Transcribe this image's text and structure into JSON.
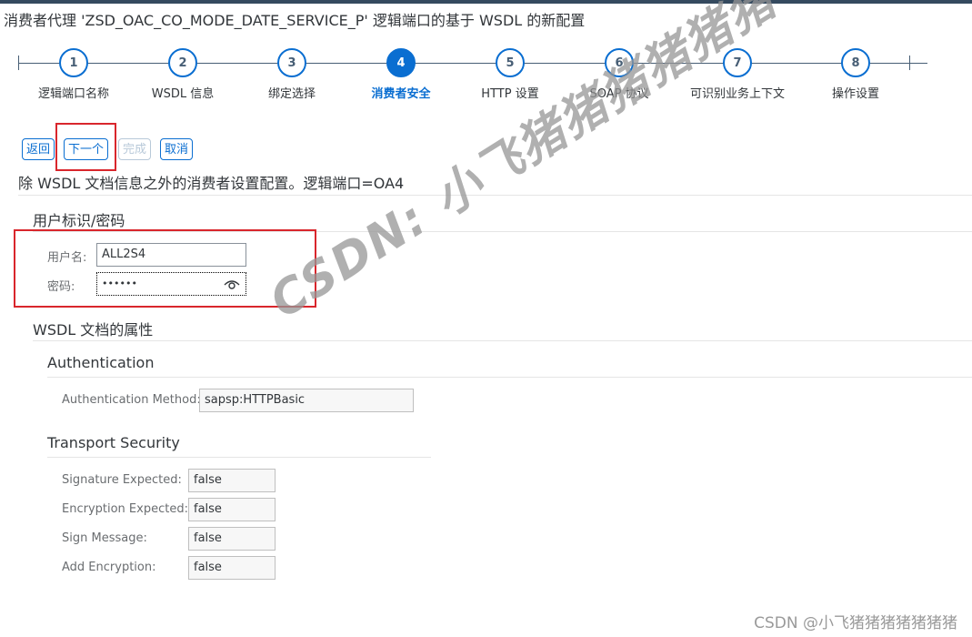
{
  "window": {
    "title": "消费者代理 'ZSD_OAC_CO_MODE_DATE_SERVICE_P' 逻辑端口的基于 WSDL 的新配置"
  },
  "wizard": {
    "steps": [
      {
        "number": "1",
        "label": "逻辑端口名称",
        "active": false
      },
      {
        "number": "2",
        "label": "WSDL 信息",
        "active": false
      },
      {
        "number": "3",
        "label": "绑定选择",
        "active": false
      },
      {
        "number": "4",
        "label": "消费者安全",
        "active": true
      },
      {
        "number": "5",
        "label": "HTTP 设置",
        "active": false
      },
      {
        "number": "6",
        "label": "SOAP 协议",
        "active": false
      },
      {
        "number": "7",
        "label": "可识别业务上下文",
        "active": false
      },
      {
        "number": "8",
        "label": "操作设置",
        "active": false
      }
    ]
  },
  "toolbar": {
    "back_label": "返回",
    "next_label": "下一个",
    "finish_label": "完成",
    "cancel_label": "取消"
  },
  "description": "除 WSDL 文档信息之外的消费者设置配置。逻辑端口=OA4",
  "credentials": {
    "title": "用户标识/密码",
    "username_label": "用户名:",
    "username_value": "ALL2S4",
    "password_label": "密码:",
    "password_value": "••••••"
  },
  "wsdl_properties": {
    "title": "WSDL 文档的属性",
    "authentication": {
      "title": "Authentication",
      "method_label": "Authentication Method:",
      "method_value": "sapsp:HTTPBasic"
    },
    "transport_security": {
      "title": "Transport Security",
      "fields": [
        {
          "label": "Signature Expected:",
          "value": "false"
        },
        {
          "label": "Encryption Expected:",
          "value": "false"
        },
        {
          "label": "Sign Message:",
          "value": "false"
        },
        {
          "label": "Add Encryption:",
          "value": "false"
        }
      ]
    }
  },
  "watermark": {
    "diagonal": "CSDN: 小飞猪猪猪猪猪猪",
    "corner": "CSDN @小飞猪猪猪猪猪猪猪"
  },
  "colors": {
    "accent": "#0a6ed1",
    "highlight_box": "#d9262c",
    "shell_bar": "#354a5f"
  }
}
